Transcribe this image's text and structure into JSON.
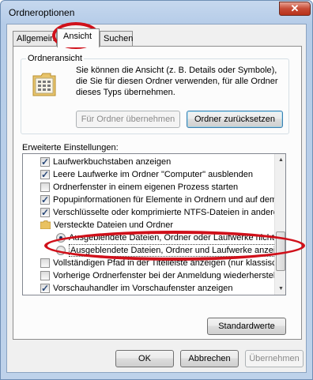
{
  "window": {
    "title": "Ordneroptionen",
    "close_label": "✕"
  },
  "tabs": [
    {
      "label": "Allgemein",
      "active": false
    },
    {
      "label": "Ansicht",
      "active": true
    },
    {
      "label": "Suchen",
      "active": false
    }
  ],
  "folder_view": {
    "group_label": "Ordneransicht",
    "description": "Sie können die Ansicht (z. B. Details oder Symbole), die Sie für diesen Ordner verwenden, für alle Ordner dieses Typs übernehmen.",
    "apply_button": "Für Ordner übernehmen",
    "reset_button": "Ordner zurücksetzen"
  },
  "advanced": {
    "label": "Erweiterte Einstellungen:",
    "items": [
      {
        "type": "checkbox",
        "checked": true,
        "indent": 1,
        "label": "Laufwerkbuchstaben anzeigen"
      },
      {
        "type": "checkbox",
        "checked": true,
        "indent": 1,
        "label": "Leere Laufwerke im Ordner \"Computer\" ausblenden"
      },
      {
        "type": "checkbox",
        "checked": false,
        "indent": 1,
        "label": "Ordnerfenster in einem eigenen Prozess starten"
      },
      {
        "type": "checkbox",
        "checked": true,
        "indent": 1,
        "label": "Popupinformationen für Elemente in Ordnern und auf dem D"
      },
      {
        "type": "checkbox",
        "checked": true,
        "indent": 1,
        "label": "Verschlüsselte oder komprimierte NTFS-Dateien in anderer"
      },
      {
        "type": "folder",
        "checked": false,
        "indent": 1,
        "label": "Versteckte Dateien und Ordner"
      },
      {
        "type": "radio",
        "checked": true,
        "indent": 2,
        "label": "Ausgeblendete Dateien, Ordner oder Laufwerke nicht a"
      },
      {
        "type": "radio",
        "checked": false,
        "indent": 2,
        "label": "Ausgeblendete Dateien, Ordner und Laufwerke anzeigen"
      },
      {
        "type": "checkbox",
        "checked": false,
        "indent": 1,
        "label": "Vollständigen Pfad in der Titelleiste anzeigen (nur klassisch"
      },
      {
        "type": "checkbox",
        "checked": false,
        "indent": 1,
        "label": "Vorherige Ordnerfenster bei der Anmeldung wiederherstellen"
      },
      {
        "type": "checkbox",
        "checked": true,
        "indent": 1,
        "label": "Vorschauhandler im Vorschaufenster anzeigen"
      }
    ]
  },
  "buttons": {
    "defaults": "Standardwerte",
    "ok": "OK",
    "cancel": "Abbrechen",
    "apply": "Übernehmen"
  },
  "colors": {
    "annotation": "#d0101a"
  }
}
